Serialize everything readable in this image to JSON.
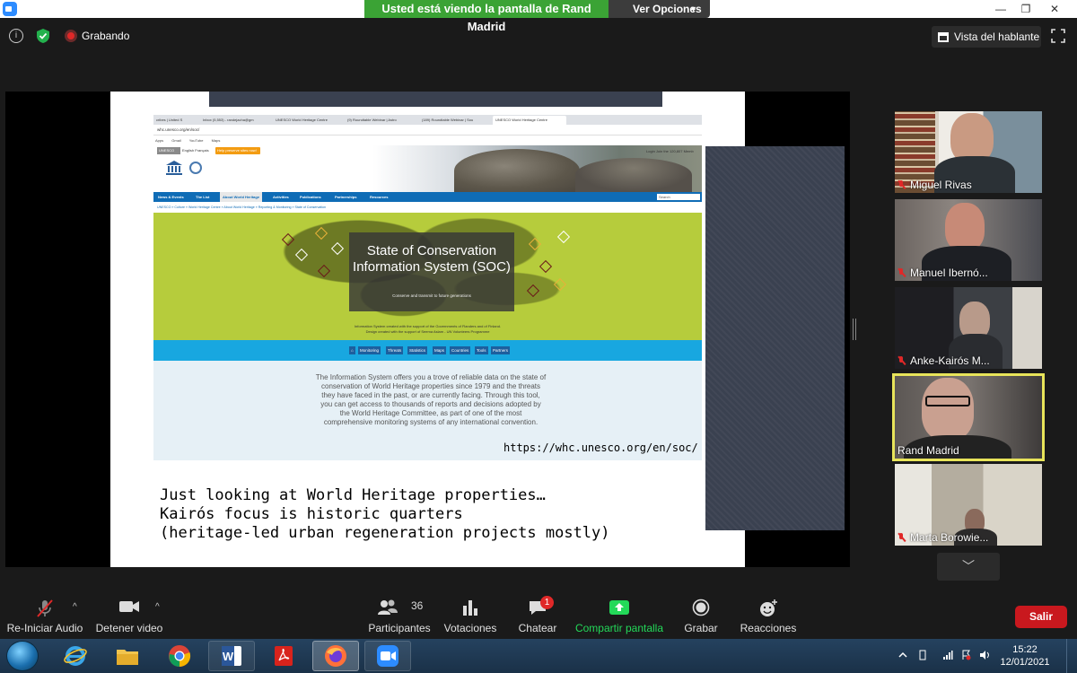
{
  "window": {
    "share_banner": "Usted está viendo la pantalla de Rand Madrid",
    "view_options": "Ver Opciones"
  },
  "meeting": {
    "recording_label": "Grabando",
    "speaker_view": "Vista del hablante"
  },
  "shared": {
    "browser": {
      "tabs": [
        "cribes | United S",
        "Inbox (5,553) - randejacha@gm",
        "UNESCO World Heritage Centre",
        "(9) Roundtable Webinar | Astro",
        "(189) Roundtable Webinar | Sou",
        "UNESCO World Heritage Centre"
      ],
      "address": "whc.unesco.org/en/soc/",
      "bookmarks": [
        "Apps",
        "Gmail",
        "YouTube",
        "Maps"
      ],
      "unesco_box": "UNESCO",
      "languages": "English  Français",
      "help_button": "Help preserve sites now!",
      "login": "Login   Join the 120,807 Memb",
      "nav": [
        "News & Events",
        "The List",
        "About World Heritage",
        "Activities",
        "Publications",
        "Partnerships",
        "Resources"
      ],
      "search_placeholder": "Search",
      "breadcrumb": "UNESCO » Culture » World Heritage Centre » About World Heritage » Reporting & Monitoring » State of Conservation",
      "soc_title": "State of Conservation Information System (SOC)",
      "soc_tagline": "Conserve and transmit to future generations",
      "soc_credit_1": "Information System created with the support of the Governments of Flanders and of Finland.",
      "soc_credit_2": "Design created with the support of Seema Aslam - UN Volunteers Programme",
      "soc_tabs": [
        "Monitoring",
        "Threats",
        "Statistics",
        "Maps",
        "Countries",
        "Tools",
        "Partners"
      ],
      "soc_description": "The Information System offers you a trove of reliable data on the state of conservation of World Heritage properties since 1979 and the threats they have faced in the past, or are currently facing. Through this tool, you can get access to thousands of reports and decisions adopted by the World Heritage Committee, as part of one of the most comprehensive monitoring systems of any international convention."
    },
    "url_caption": "https://whc.unesco.org/en/soc/",
    "slide_text": "Just looking at World Heritage properties…\nKairós focus is historic quarters\n(heritage-led urban regeneration projects mostly)"
  },
  "participants": [
    {
      "name": "Miguel Rivas",
      "muted": true,
      "active": false
    },
    {
      "name": "Manuel Ibernó...",
      "muted": true,
      "active": false
    },
    {
      "name": "Anke-Kairós M...",
      "muted": true,
      "active": false
    },
    {
      "name": "Rand Madrid",
      "muted": false,
      "active": true
    },
    {
      "name": "Marta Borowie...",
      "muted": true,
      "active": false
    }
  ],
  "toolbar": {
    "audio": "Re-Iniciar Audio",
    "video": "Detener video",
    "participants": "Participantes",
    "participants_count": "36",
    "polls": "Votaciones",
    "chat": "Chatear",
    "chat_badge": "1",
    "share": "Compartir pantalla",
    "record": "Grabar",
    "reactions": "Reacciones",
    "leave": "Salir"
  },
  "taskbar": {
    "time": "15:22",
    "date": "12/01/2021"
  },
  "colors": {
    "share_banner": "#3ba335",
    "leave": "#c9181e",
    "share_icon": "#23d959",
    "active_speaker": "#e8e45a"
  }
}
